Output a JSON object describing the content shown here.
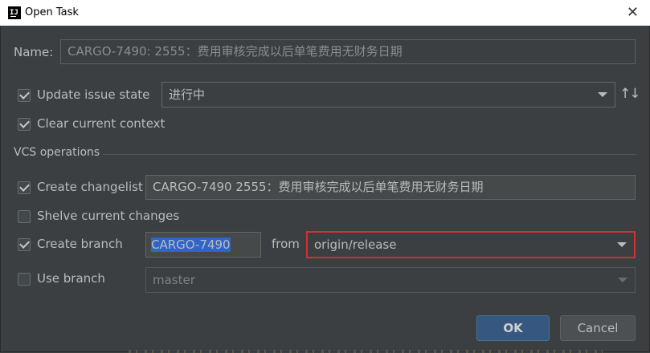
{
  "window": {
    "title": "Open Task"
  },
  "name_field": {
    "label": "Name:",
    "value": "CARGO-7490: 2555：费用审核完成以后单笔费用无财务日期"
  },
  "update_issue_state": {
    "label": "Update issue state",
    "checked": true,
    "selected": "进行中"
  },
  "clear_context": {
    "label": "Clear current context",
    "checked": true
  },
  "vcs": {
    "title": "VCS operations",
    "create_changelist": {
      "label": "Create changelist",
      "checked": true,
      "value": "CARGO-7490 2555：费用审核完成以后单笔费用无财务日期"
    },
    "shelve": {
      "label": "Shelve current changes",
      "checked": false
    },
    "create_branch": {
      "label": "Create branch",
      "checked": true,
      "value": "CARGO-7490",
      "from_label": "from",
      "from_value": "origin/release"
    },
    "use_branch": {
      "label": "Use branch",
      "checked": false,
      "value": "master"
    }
  },
  "buttons": {
    "ok": "OK",
    "cancel": "Cancel"
  },
  "colors": {
    "background": "#3c3f41",
    "accent": "#365880",
    "highlight_border": "#d63030",
    "selection": "#2f65ca"
  },
  "icons": {
    "app": "intellij-icon",
    "close": "close-icon",
    "sort": "sort-arrows-icon"
  }
}
